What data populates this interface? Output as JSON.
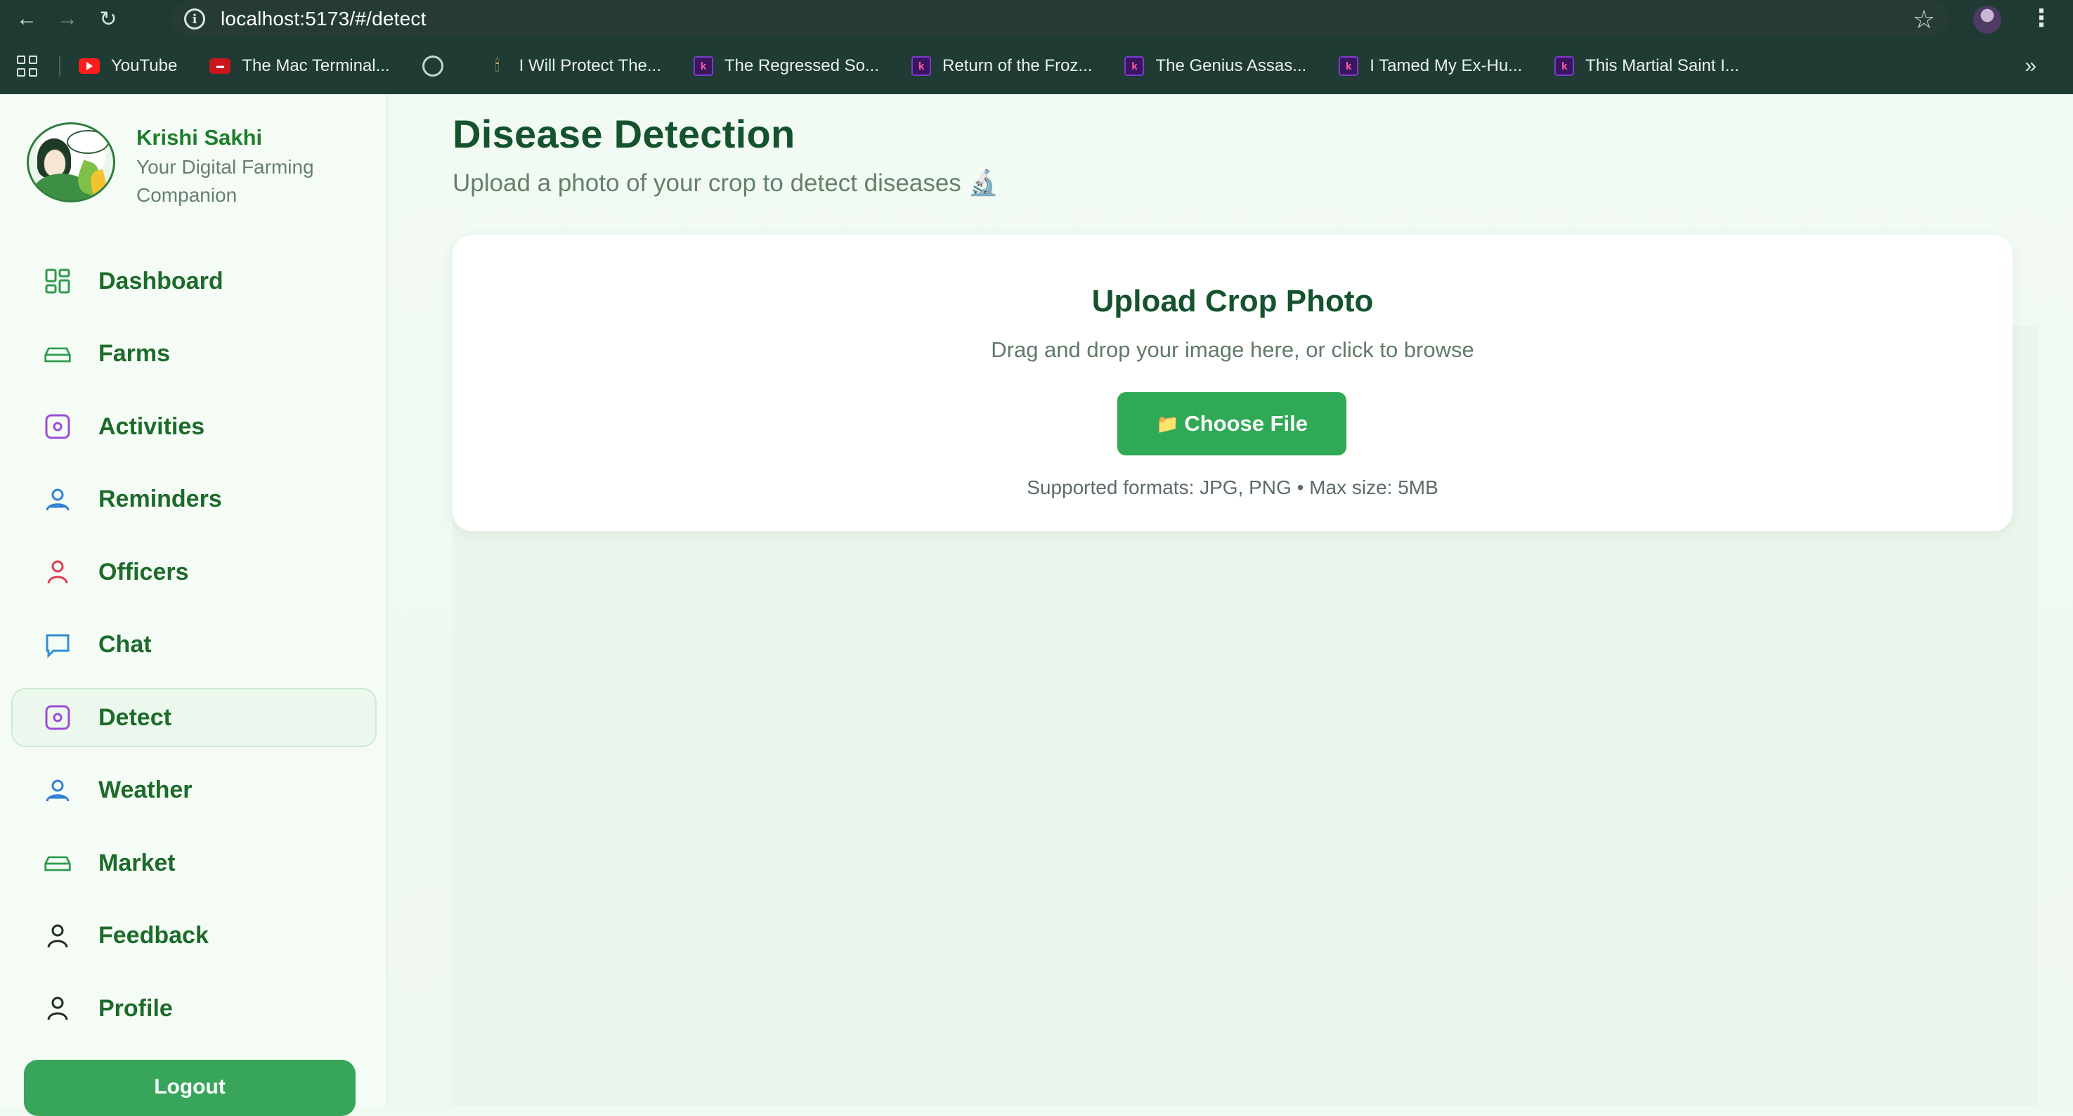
{
  "browser": {
    "url": "localhost:5173/#/detect",
    "bookmarks": [
      {
        "label": "YouTube",
        "icon": "youtube-icon"
      },
      {
        "label": "The Mac Terminal...",
        "icon": "red-badge-icon"
      },
      {
        "label": "",
        "icon": "globe-icon"
      },
      {
        "label": "I Will Protect The...",
        "icon": "candle-icon"
      },
      {
        "label": "The Regressed So...",
        "icon": "story-icon"
      },
      {
        "label": "Return of the Froz...",
        "icon": "story-icon"
      },
      {
        "label": "The Genius Assas...",
        "icon": "story-icon"
      },
      {
        "label": "I Tamed My Ex-Hu...",
        "icon": "story-icon"
      },
      {
        "label": "This Martial Saint I...",
        "icon": "story-icon"
      }
    ]
  },
  "brand": {
    "name": "Krishi Sakhi",
    "tagline": "Your Digital Farming Companion"
  },
  "nav": {
    "items": [
      {
        "label": "Dashboard",
        "icon": "grid-icon",
        "color": "#2e9a4c"
      },
      {
        "label": "Farms",
        "icon": "field-icon",
        "color": "#2e9a4c"
      },
      {
        "label": "Activities",
        "icon": "activity-icon",
        "color": "#9b4dd6"
      },
      {
        "label": "Reminders",
        "icon": "users-icon",
        "color": "#2f7fd6"
      },
      {
        "label": "Officers",
        "icon": "officer-icon",
        "color": "#e23a4f"
      },
      {
        "label": "Chat",
        "icon": "chat-icon",
        "color": "#2f8fd6"
      },
      {
        "label": "Detect",
        "icon": "detect-icon",
        "color": "#9b4dd6",
        "active": true
      },
      {
        "label": "Weather",
        "icon": "users-icon",
        "color": "#2f7fd6"
      },
      {
        "label": "Market",
        "icon": "field-icon",
        "color": "#2e9a4c"
      },
      {
        "label": "Feedback",
        "icon": "user-icon",
        "color": "#1f2b24"
      },
      {
        "label": "Profile",
        "icon": "user-icon",
        "color": "#1f2b24"
      }
    ],
    "logout": "Logout"
  },
  "page": {
    "title": "Disease Detection",
    "subtitle": "Upload a photo of your crop to detect diseases 🔬"
  },
  "upload": {
    "title": "Upload Crop Photo",
    "subtitle": "Drag and drop your image here, or click to browse",
    "button": "Choose File",
    "note": "Supported formats: JPG, PNG • Max size: 5MB"
  },
  "colors": {
    "accent": "#2fa956",
    "heading": "#14532d",
    "nav_text": "#1d6b2a"
  }
}
